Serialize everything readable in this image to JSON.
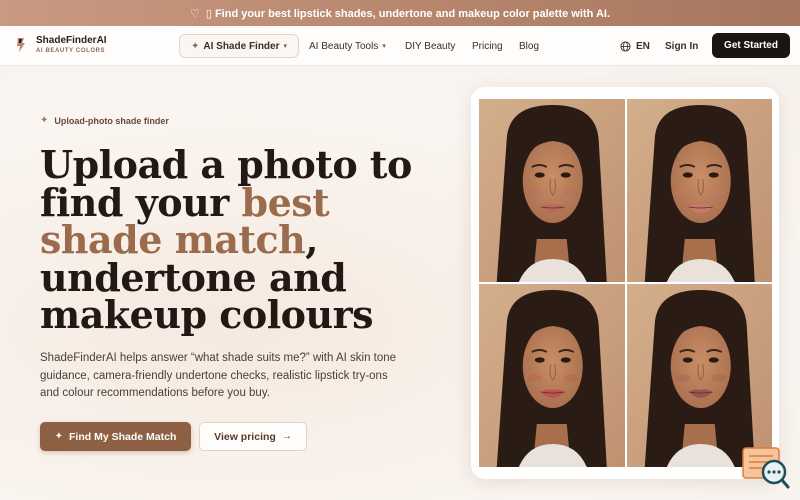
{
  "promo": {
    "text": "▯ Find your best lipstick shades, undertone and makeup color palette with AI."
  },
  "brand": {
    "name": "ShadeFinderAI",
    "tagline": "AI BEAUTY COLORS"
  },
  "nav": {
    "items": [
      {
        "label": "AI Shade Finder"
      },
      {
        "label": "AI Beauty Tools"
      },
      {
        "label": "DIY Beauty"
      },
      {
        "label": "Pricing"
      },
      {
        "label": "Blog"
      }
    ],
    "language": "EN",
    "signin": "Sign In",
    "cta": "Get Started"
  },
  "hero": {
    "eyebrow": "Upload-photo shade finder",
    "headline_part1": "Upload a photo to find your ",
    "headline_accent": "best shade match",
    "headline_part2": ", undertone and makeup colours",
    "description": "ShadeFinderAI helps answer “what shade suits me?” with AI skin tone guidance, camera-friendly undertone checks, realistic lipstick try-ons and colour recommendations before you buy.",
    "primary_button": "Find My Shade Match",
    "secondary_button": "View pricing"
  },
  "colors": {
    "accent": "#9a6b4c",
    "primary_button": "#8d5f43",
    "dark": "#1c1613",
    "promo_bar": "#b8876e"
  },
  "photos": {
    "lip_colors": [
      "#b8695e",
      "#c9786c",
      "#c0524d",
      "#9a5550"
    ]
  }
}
